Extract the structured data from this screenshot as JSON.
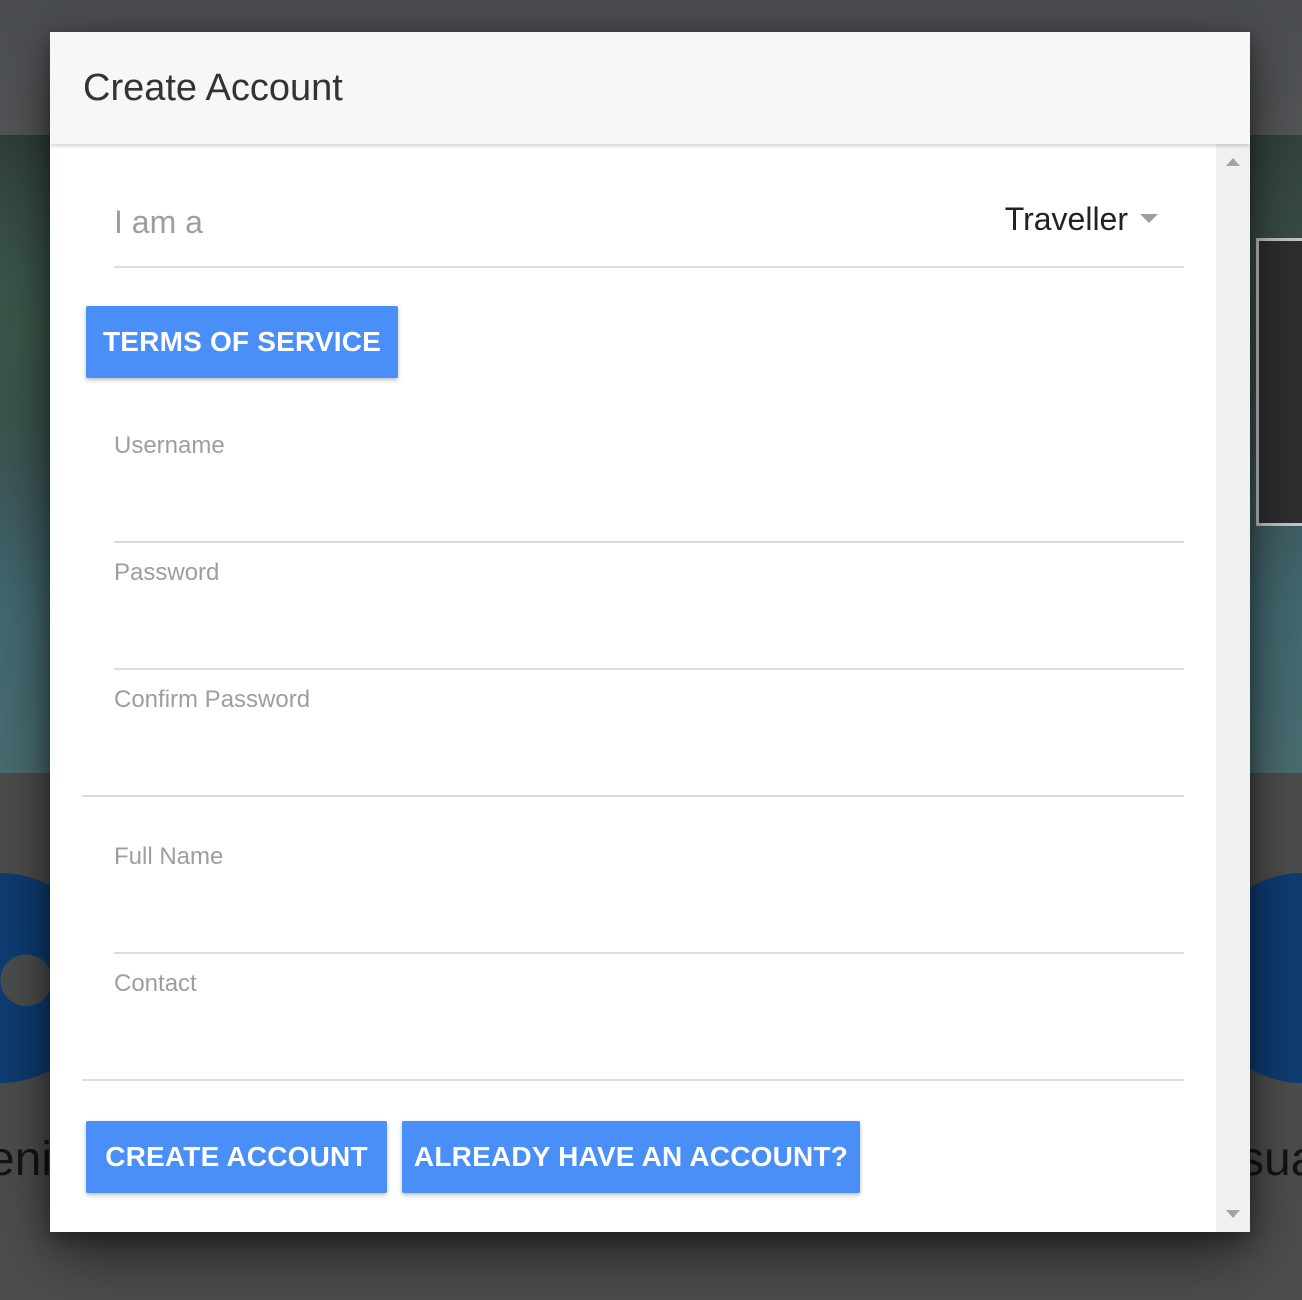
{
  "background": {
    "left_word": "eni",
    "right_word": "sua"
  },
  "modal": {
    "title": "Create Account",
    "role_select": {
      "label": "I am a",
      "value": "Traveller"
    },
    "terms_button": "Terms of Service",
    "fields": {
      "username": {
        "label": "Username",
        "value": ""
      },
      "password": {
        "label": "Password",
        "value": ""
      },
      "confirm_password": {
        "label": "Confirm Password",
        "value": ""
      },
      "full_name": {
        "label": "Full Name",
        "value": ""
      },
      "contact": {
        "label": "Contact",
        "value": ""
      }
    },
    "create_button": "Create Account",
    "login_button": "Already have an account?"
  },
  "colors": {
    "primary_button": "#4a8ef8",
    "header_background": "#f7f7f7",
    "label_gray": "#9e9e9e"
  },
  "icons": [
    "caret-down-icon",
    "scroll-up-arrow-icon",
    "scroll-down-arrow-icon"
  ]
}
